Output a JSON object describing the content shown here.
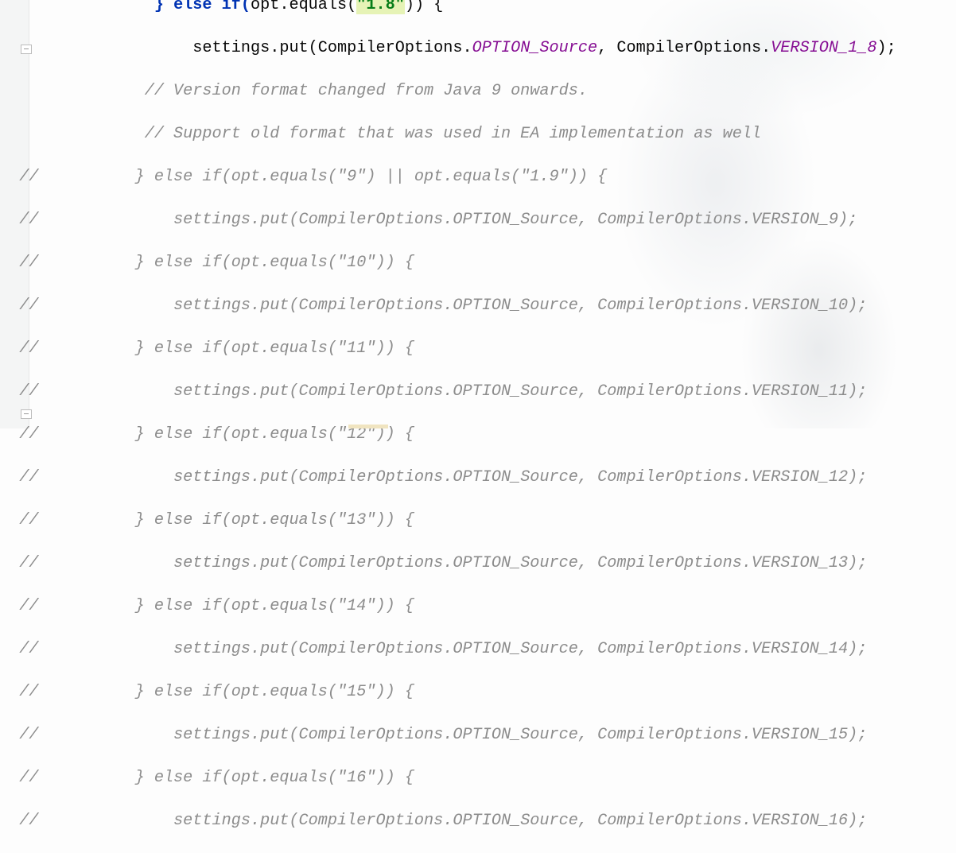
{
  "editor": {
    "lines": [
      {
        "gutter": "",
        "indent": "                ",
        "kw": "} else if(",
        "pre": "opt.equals(",
        "str": "\"1.8\"",
        "post": ")) {"
      },
      {
        "gutter": "",
        "indent": "                    ",
        "pre": "settings.put(CompilerOptions.",
        "fld1": "OPTION_Source",
        "mid": ", CompilerOptions.",
        "fld2": "VERSION_1_8",
        "post": ");"
      },
      {
        "gutter": "",
        "indent": "               ",
        "comment": "// Version format changed from Java 9 onwards."
      },
      {
        "gutter": "",
        "indent": "               ",
        "comment": "// Support old format that was used in EA implementation as well"
      },
      {
        "gutter": "//",
        "comment": "          } else if(opt.equals(\"9\") || opt.equals(\"1.9\")) {"
      },
      {
        "gutter": "//",
        "comment": "              settings.put(CompilerOptions.OPTION_Source, CompilerOptions.VERSION_9);"
      },
      {
        "gutter": "//",
        "comment": "          } else if(opt.equals(\"10\")) {"
      },
      {
        "gutter": "//",
        "comment": "              settings.put(CompilerOptions.OPTION_Source, CompilerOptions.VERSION_10);"
      },
      {
        "gutter": "//",
        "comment": "          } else if(opt.equals(\"11\")) {"
      },
      {
        "gutter": "//",
        "comment": "              settings.put(CompilerOptions.OPTION_Source, CompilerOptions.VERSION_11);"
      },
      {
        "gutter": "//",
        "comment": "          } else if(opt.equals(\"12\")) {"
      },
      {
        "gutter": "//",
        "comment": "              settings.put(CompilerOptions.OPTION_Source, CompilerOptions.VERSION_12);"
      },
      {
        "gutter": "//",
        "comment": "          } else if(opt.equals(\"13\")) {"
      },
      {
        "gutter": "//",
        "comment": "              settings.put(CompilerOptions.OPTION_Source, CompilerOptions.VERSION_13);"
      },
      {
        "gutter": "//",
        "comment": "          } else if(opt.equals(\"14\")) {"
      },
      {
        "gutter": "//",
        "comment": "              settings.put(CompilerOptions.OPTION_Source, CompilerOptions.VERSION_14);"
      },
      {
        "gutter": "//",
        "comment": "          } else if(opt.equals(\"15\")) {"
      },
      {
        "gutter": "//",
        "comment": "              settings.put(CompilerOptions.OPTION_Source, CompilerOptions.VERSION_15);"
      },
      {
        "gutter": "//",
        "comment": "          } else if(opt.equals(\"16\")) {"
      },
      {
        "gutter": "//",
        "comment": "              settings.put(CompilerOptions.OPTION_Source, CompilerOptions.VERSION_16);"
      }
    ]
  },
  "icons": {
    "fold_start": "fold-marker-icon",
    "fold_end": "fold-marker-icon"
  },
  "colors": {
    "keyword": "#0033b3",
    "string": "#067d17",
    "string_bg": "#e6f3b6",
    "field": "#871094",
    "comment": "#8c8c8c"
  }
}
